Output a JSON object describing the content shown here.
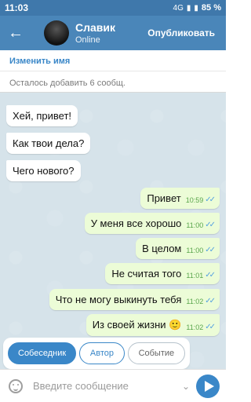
{
  "status_bar": {
    "time": "11:03",
    "network": "4G",
    "battery": "85 %"
  },
  "header": {
    "contact_name": "Славик",
    "contact_status": "Online",
    "publish_label": "Опубликовать"
  },
  "editor": {
    "edit_name_label": "Изменить имя",
    "remaining_text": "Осталось добавить 6 сообщ."
  },
  "messages": [
    {
      "text": "Хей, привет!",
      "dir": "in"
    },
    {
      "text": "Как твои дела?",
      "dir": "in"
    },
    {
      "text": "Чего нового?",
      "dir": "in"
    },
    {
      "text": "Привет",
      "time": "10:59",
      "dir": "out"
    },
    {
      "text": "У меня все хорошо",
      "time": "11:00",
      "dir": "out"
    },
    {
      "text": "В целом",
      "time": "11:00",
      "dir": "out"
    },
    {
      "text": "Не считая того",
      "time": "11:01",
      "dir": "out"
    },
    {
      "text": "Что не могу выкинуть тебя",
      "time": "11:02",
      "dir": "out"
    },
    {
      "text": "Из своей жизни 🙂",
      "time": "11:02",
      "dir": "out"
    }
  ],
  "role_picker": {
    "interlocutor": "Собеседник",
    "author": "Автор",
    "event": "Событие"
  },
  "composer": {
    "placeholder": "Введите сообщение"
  },
  "colors": {
    "header": "#4a86b9",
    "accent": "#3a87c8",
    "chat_background": "#d6e3ea",
    "outgoing_bubble": "#ecfcd7"
  }
}
